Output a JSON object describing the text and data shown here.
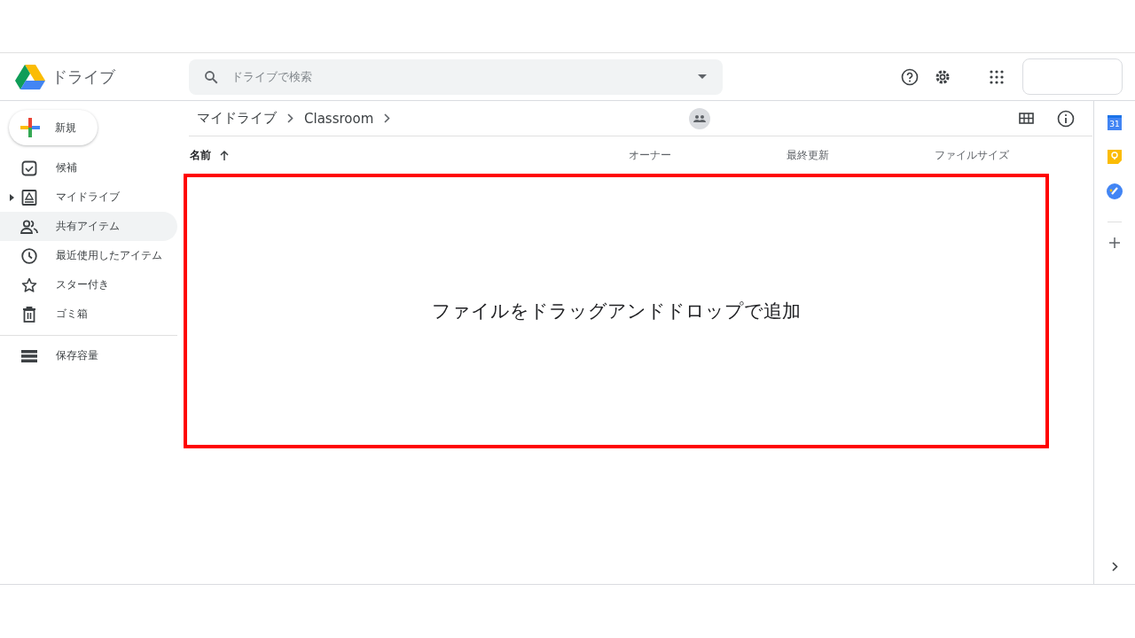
{
  "header": {
    "app_name": "ドライブ",
    "search": {
      "placeholder": "ドライブで検索"
    }
  },
  "new_button": {
    "label": "新規"
  },
  "sidebar": {
    "items": [
      {
        "kind": "suggested",
        "label": "候補",
        "selected": false,
        "expandable": false
      },
      {
        "kind": "my-drive",
        "label": "マイドライブ",
        "selected": false,
        "expandable": true
      },
      {
        "kind": "shared",
        "label": "共有アイテム",
        "selected": true,
        "expandable": false
      },
      {
        "kind": "recent",
        "label": "最近使用したアイテム",
        "selected": false,
        "expandable": false
      },
      {
        "kind": "starred",
        "label": "スター付き",
        "selected": false,
        "expandable": false
      },
      {
        "kind": "trash",
        "label": "ゴミ箱",
        "selected": false,
        "expandable": false
      }
    ],
    "storage": {
      "label": "保存容量"
    }
  },
  "breadcrumb": [
    "マイドライブ",
    "Classroom"
  ],
  "table": {
    "columns": [
      {
        "label": "名前",
        "sorted": true
      },
      {
        "label": "オーナー",
        "sorted": false
      },
      {
        "label": "最終更新",
        "sorted": false
      },
      {
        "label": "ファイルサイズ",
        "sorted": false
      }
    ]
  },
  "drop_zone": {
    "text": "ファイルをドラッグアンドドロップで追加"
  },
  "side_panel": {
    "calendar_day": "31"
  }
}
